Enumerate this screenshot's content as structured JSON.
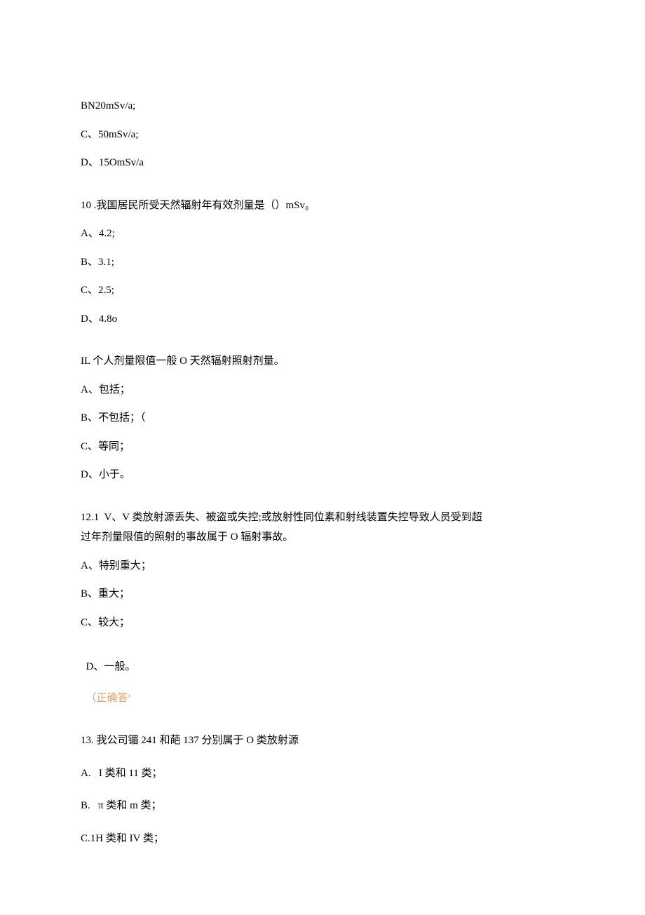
{
  "q9_partial": {
    "optB": "BN20mSv/a;",
    "optC": "C、50mSv/a;",
    "optD": "D、15OmSv/a"
  },
  "q10": {
    "stem": "10 .我国居民所受天然辐射年有效剂量是（）mSv₀",
    "optA": "A、4.2;",
    "optB": "B、3.1;",
    "optC": "C、2.5;",
    "optD": "D、4.8o"
  },
  "q11": {
    "stem": "IL 个人剂量限值一般 O 天然辐射照射剂量。",
    "optA": "A、包括；",
    "optB": "B、不包括；（",
    "optC": "C、等同；",
    "optD": "D、小于。"
  },
  "q12": {
    "stem_line1": "12.1  V、V 类放射源丢失、被盗或失控;或放射性同位素和射线装置失控导致人员受到超",
    "stem_line2": "过年剂量限值的照射的事故属于 O 辐射事故。",
    "optA": "A、特别重大；",
    "optB": "B、重大；",
    "optC": "C、较大；",
    "optD_text": "D、一般。",
    "optD_ans": "（正确答‘"
  },
  "q13": {
    "stem": "13. 我公司镅 241 和葩 137 分别属于 O 类放射源",
    "optA": "A.   I 类和 11 类；",
    "optB": "B.   π 类和 m 类；",
    "optC": "C.1H 类和 IV 类；"
  }
}
